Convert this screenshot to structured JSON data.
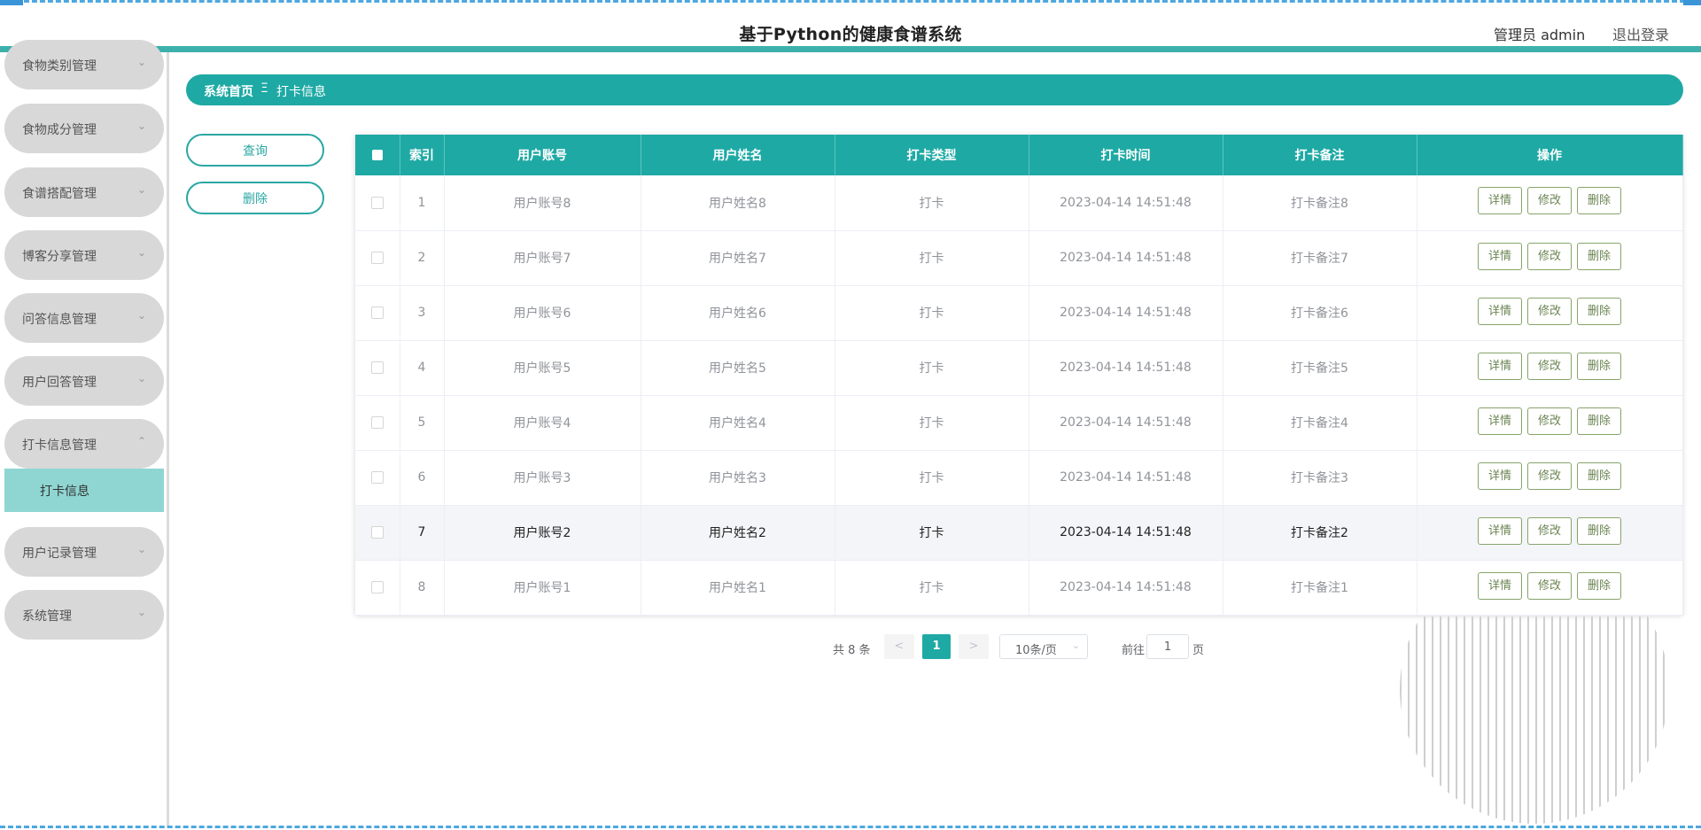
{
  "header": {
    "title": "基于Python的健康食谱系统",
    "admin_label": "管理员 admin",
    "logout_label": "退出登录"
  },
  "sidebar": {
    "items": [
      {
        "label": "食物类别管理",
        "arrow": "⌄"
      },
      {
        "label": "食物成分管理",
        "arrow": "⌄"
      },
      {
        "label": "食谱搭配管理",
        "arrow": "⌄"
      },
      {
        "label": "博客分享管理",
        "arrow": "⌄"
      },
      {
        "label": "问答信息管理",
        "arrow": "⌄"
      },
      {
        "label": "用户回答管理",
        "arrow": "⌄"
      },
      {
        "label": "打卡信息管理",
        "arrow": "⌃"
      },
      {
        "label": "用户记录管理",
        "arrow": "⌄"
      },
      {
        "label": "系统管理",
        "arrow": "⌄"
      }
    ],
    "active_sub": "打卡信息"
  },
  "breadcrumb": {
    "home": "系统首页",
    "sep": "Ξ",
    "current": "打卡信息"
  },
  "actions": {
    "query_label": "查询",
    "delete_label": "删除"
  },
  "table": {
    "headers": [
      "索引",
      "用户账号",
      "用户姓名",
      "打卡类型",
      "打卡时间",
      "打卡备注",
      "操作"
    ],
    "rows": [
      {
        "index": "1",
        "account": "用户账号8",
        "name": "用户姓名8",
        "type": "打卡",
        "time": "2023-04-14 14:51:48",
        "note": "打卡备注8"
      },
      {
        "index": "2",
        "account": "用户账号7",
        "name": "用户姓名7",
        "type": "打卡",
        "time": "2023-04-14 14:51:48",
        "note": "打卡备注7"
      },
      {
        "index": "3",
        "account": "用户账号6",
        "name": "用户姓名6",
        "type": "打卡",
        "time": "2023-04-14 14:51:48",
        "note": "打卡备注6"
      },
      {
        "index": "4",
        "account": "用户账号5",
        "name": "用户姓名5",
        "type": "打卡",
        "time": "2023-04-14 14:51:48",
        "note": "打卡备注5"
      },
      {
        "index": "5",
        "account": "用户账号4",
        "name": "用户姓名4",
        "type": "打卡",
        "time": "2023-04-14 14:51:48",
        "note": "打卡备注4"
      },
      {
        "index": "6",
        "account": "用户账号3",
        "name": "用户姓名3",
        "type": "打卡",
        "time": "2023-04-14 14:51:48",
        "note": "打卡备注3"
      },
      {
        "index": "7",
        "account": "用户账号2",
        "name": "用户姓名2",
        "type": "打卡",
        "time": "2023-04-14 14:51:48",
        "note": "打卡备注2"
      },
      {
        "index": "8",
        "account": "用户账号1",
        "name": "用户姓名1",
        "type": "打卡",
        "time": "2023-04-14 14:51:48",
        "note": "打卡备注1"
      }
    ],
    "op_labels": {
      "detail": "详情",
      "edit": "修改",
      "delete": "删除"
    }
  },
  "pagination": {
    "total": "共 8 条",
    "prev": "<",
    "current_page": "1",
    "next": ">",
    "page_size": "10条/页",
    "page_size_arrow": "⌄",
    "goto_label": "前往",
    "goto_value": "1",
    "page_unit": "页"
  },
  "colors": {
    "primary": "#1ea9a4",
    "header_bar": "#3db0ac",
    "active_submenu": "#8fd6d2",
    "op_button_border": "#86a46a"
  }
}
